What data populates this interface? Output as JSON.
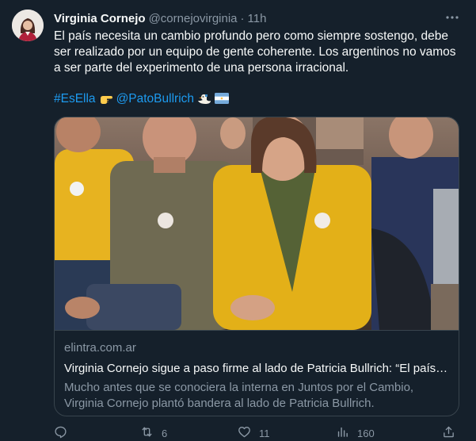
{
  "author": {
    "name": "Virginia Cornejo",
    "handle": "@cornejovirginia",
    "separator": "·",
    "time": "11h"
  },
  "tweet": {
    "text": "El país necesita un cambio profundo pero como siempre sostengo, debe ser realizado por un equipo de gente coherente. Los argentinos no vamos a ser parte del experimento de una persona irracional.",
    "hashtag": "#EsElla",
    "mention": "@PatoBullrich"
  },
  "card": {
    "domain": "elintra.com.ar",
    "title": "Virginia Cornejo sigue a paso firme al lado de Patricia Bullrich: “El país…",
    "description": "Mucho antes que se conociera la interna en Juntos por el Cambio, Virginia Cornejo plantó bandera al lado de Patricia Bullrich."
  },
  "actions": {
    "replies": "",
    "retweets": "6",
    "likes": "11",
    "views": "160"
  },
  "icons": [
    "more-icon",
    "pointing-hand-emoji",
    "duck-emoji",
    "argentina-flag-emoji",
    "reply-icon",
    "retweet-icon",
    "like-icon",
    "views-icon",
    "share-icon"
  ],
  "colors": {
    "background": "#15202b",
    "link": "#1d9bf0",
    "secondary_text": "#8b98a5",
    "border": "#38444d"
  }
}
